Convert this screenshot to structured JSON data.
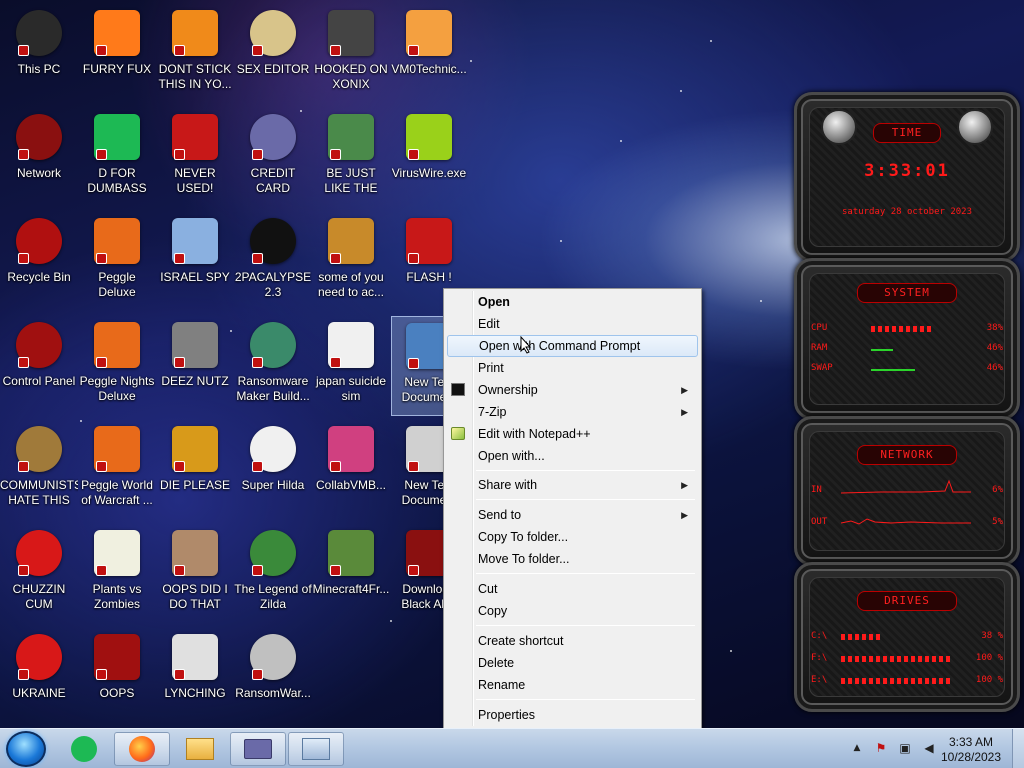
{
  "desktop": {
    "icons": [
      {
        "label": "This PC",
        "icon": "computer-icon",
        "color": "#2a2a2a"
      },
      {
        "label": "FURRY FUX",
        "icon": "firefox-icon",
        "color": "#ff7a1a"
      },
      {
        "label": "DONT STICK THIS IN YO...",
        "icon": "vlc-cone-icon",
        "color": "#f08a1a"
      },
      {
        "label": "SEX EDITOR",
        "icon": "hxd-icon",
        "color": "#d8c48a"
      },
      {
        "label": "HOOKED ON XONIX",
        "icon": "xonix-game-icon",
        "color": "#444444"
      },
      {
        "label": "VM0Technic...",
        "icon": "doctor-icon",
        "color": "#f4a040"
      },
      {
        "label": "Network",
        "icon": "alien-network-icon",
        "color": "#8a1010"
      },
      {
        "label": "D FOR DUMBASS",
        "icon": "chat-bubble-icon",
        "color": "#1db954"
      },
      {
        "label": "NEVER USED!",
        "icon": "dev-cpp-icon",
        "color": "#c81818"
      },
      {
        "label": "CREDIT CARD CHECKER",
        "icon": "credit-card-icon",
        "color": "#6a6aa8"
      },
      {
        "label": "BE JUST LIKE THE DUDE!",
        "icon": "santa-icon",
        "color": "#4a8a4a"
      },
      {
        "label": "VirusWire.exe",
        "icon": "lime-icon",
        "color": "#9ad11a"
      },
      {
        "label": "Recycle Bin",
        "icon": "recycle-bin-icon",
        "color": "#b01010"
      },
      {
        "label": "Peggle Deluxe",
        "icon": "peggle-icon",
        "color": "#e86a1a"
      },
      {
        "label": "ISRAEL SPY",
        "icon": "network-spy-icon",
        "color": "#8ab0e0"
      },
      {
        "label": "2PACALYPSE 2.3",
        "icon": "terminal-icon",
        "color": "#111111"
      },
      {
        "label": "some of you need to ac...",
        "icon": "dog-icon",
        "color": "#c88a2a"
      },
      {
        "label": "FLASH !",
        "icon": "flash-icon",
        "color": "#c81818"
      },
      {
        "label": "Control Panel",
        "icon": "control-panel-icon",
        "color": "#a01010"
      },
      {
        "label": "Peggle Nights Deluxe",
        "icon": "peggle-nights-icon",
        "color": "#e86a1a"
      },
      {
        "label": "DEEZ NUTZ",
        "icon": "windows-stack-icon",
        "color": "#808080"
      },
      {
        "label": "Ransomware Maker Build...",
        "icon": "window-app-icon",
        "color": "#3a8a6a"
      },
      {
        "label": "japan suicide sim",
        "icon": "document-icon",
        "color": "#f0f0f0"
      },
      {
        "label": "New Text Document",
        "icon": "script-icon",
        "color": "#4a80c0"
      },
      {
        "label": "COMMUNISTS HATE THIS G...",
        "icon": "money-bag-icon",
        "color": "#a07a3a"
      },
      {
        "label": "Peggle World of Warcraft ...",
        "icon": "peggle-wow-icon",
        "color": "#e86a1a"
      },
      {
        "label": "DIE PLEASE",
        "icon": "after-effects-icon",
        "color": "#d89a1a"
      },
      {
        "label": "Super Hilda",
        "icon": "pixel-dog-icon",
        "color": "#f0f0f0"
      },
      {
        "label": "CollabVMB...",
        "icon": "monitor-icon",
        "color": "#d04080"
      },
      {
        "label": "New Text Document",
        "icon": "gear-document-icon",
        "color": "#d0d0d0"
      },
      {
        "label": "CHUZZIN CUM",
        "icon": "chuzzle-icon",
        "color": "#d81818"
      },
      {
        "label": "Plants vs Zombies",
        "icon": "flower-icon",
        "color": "#f0f0e0"
      },
      {
        "label": "OOPS DID I DO THAT",
        "icon": "portrait-icon",
        "color": "#b08a6a"
      },
      {
        "label": "The Legend of Zilda",
        "icon": "zelda-icon",
        "color": "#3a8a3a"
      },
      {
        "label": "Minecraft4Fr...",
        "icon": "grass-block-icon",
        "color": "#5a8a3a"
      },
      {
        "label": "Download Black Ali...",
        "icon": "alien-download-icon",
        "color": "#8a1010"
      },
      {
        "label": "UKRAINE",
        "icon": "radiation-icon",
        "color": "#d81818"
      },
      {
        "label": "OOPS",
        "icon": "book-icon",
        "color": "#a01010"
      },
      {
        "label": "LYNCHING",
        "icon": "noose-icon",
        "color": "#e0e0e0"
      },
      {
        "label": "RansomWar...",
        "icon": "skull-icon",
        "color": "#c0c0c0"
      }
    ]
  },
  "gadgets": {
    "time": {
      "title": "TIME",
      "clock": "3:33:01",
      "date": "saturday 28 october 2023"
    },
    "system": {
      "title": "SYSTEM",
      "rows": [
        {
          "key": "CPU",
          "value": "38%"
        },
        {
          "key": "RAM",
          "value": "46%"
        },
        {
          "key": "SWAP",
          "value": "46%"
        }
      ]
    },
    "network": {
      "title": "NETWORK",
      "rows": [
        {
          "key": "IN",
          "value": "6%"
        },
        {
          "key": "OUT",
          "value": "5%"
        }
      ]
    },
    "drives": {
      "title": "DRIVES",
      "rows": [
        {
          "key": "C:\\",
          "value": "38 %"
        },
        {
          "key": "F:\\",
          "value": "100 %"
        },
        {
          "key": "E:\\",
          "value": "100 %"
        }
      ]
    }
  },
  "context_menu": {
    "items": [
      {
        "label": "Open"
      },
      {
        "label": "Edit"
      },
      {
        "label": "Open with Command Prompt"
      },
      {
        "label": "Print"
      },
      {
        "label": "Ownership"
      },
      {
        "label": "7-Zip"
      },
      {
        "label": "Edit with Notepad++"
      },
      {
        "label": "Open with..."
      },
      {
        "label": "Share with"
      },
      {
        "label": "Send to"
      },
      {
        "label": "Copy To folder..."
      },
      {
        "label": "Move To folder..."
      },
      {
        "label": "Cut"
      },
      {
        "label": "Copy"
      },
      {
        "label": "Create shortcut"
      },
      {
        "label": "Delete"
      },
      {
        "label": "Rename"
      },
      {
        "label": "Properties"
      }
    ]
  },
  "taskbar": {
    "pinned": [
      "chat-bubble-icon",
      "firefox-icon",
      "file-explorer-icon",
      "credit-card-icon",
      "task-manager-icon"
    ],
    "clock": {
      "time": "3:33 AM",
      "date": "10/28/2023"
    },
    "tray_icons": [
      "show-hidden-icons-icon",
      "action-center-flag-icon",
      "network-icon",
      "volume-icon"
    ]
  },
  "colors": {
    "accent_red": "#ff1a1a",
    "menu_highlight": "#dce9f8",
    "taskbar": "#b3c8e2"
  }
}
